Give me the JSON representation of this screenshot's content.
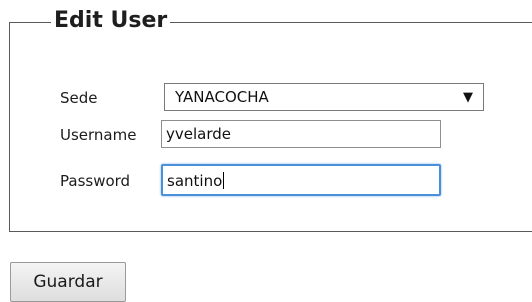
{
  "form": {
    "legend": "Edit User",
    "fields": {
      "sede": {
        "label": "Sede",
        "value": "YANACOCHA",
        "icon": "chevron-down-icon"
      },
      "username": {
        "label": "Username",
        "value": "yvelarde"
      },
      "password": {
        "label": "Password",
        "value": "santino"
      }
    }
  },
  "actions": {
    "save_label": "Guardar"
  }
}
